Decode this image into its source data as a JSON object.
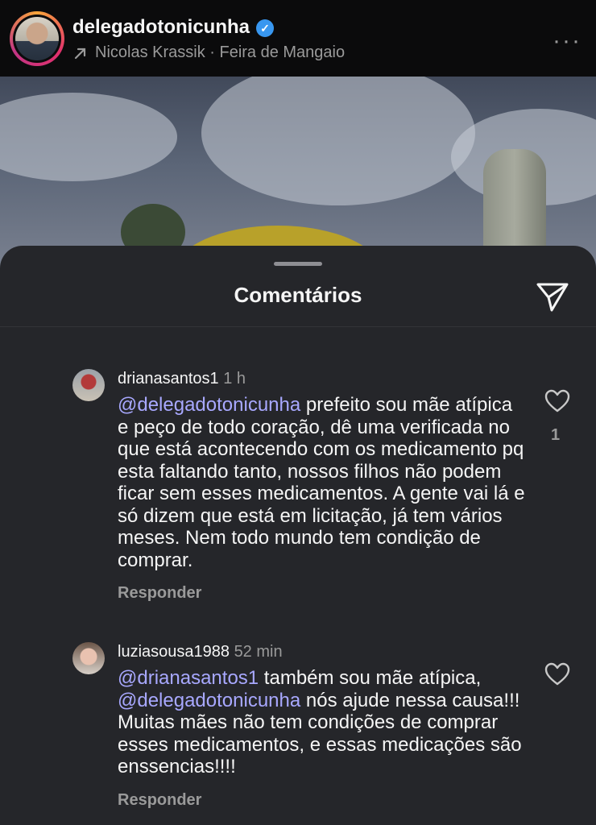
{
  "header": {
    "username": "delegadotonicunha",
    "verified_mark": "✓",
    "music_line": "Nicolas Krassik · Feira de Mangaio",
    "more": "···"
  },
  "sheet": {
    "title": "Comentários"
  },
  "comments": [
    {
      "username": "drianasantos1",
      "time": "1 h",
      "mention": "@delegadotonicunha",
      "text": " prefeito sou mãe atípica e peço de todo coração, dê uma verificada no que está acontecendo com os medicamento pq esta faltando tanto, nossos filhos não podem ficar sem esses medicamentos. A gente vai lá e só dizem que está em licitação, já tem vários meses. Nem todo mundo tem condição de comprar.",
      "likes": "1",
      "reply_label": "Responder"
    },
    {
      "username": "luziasousa1988",
      "time": "52 min",
      "mention": "@drianasantos1",
      "text_1": " também sou mãe atípica,",
      "mention_2": "@delegadotonicunha",
      "text_2": " nós ajude nessa causa!!! Muitas mães não tem condições de comprar esses medicamentos, e essas medicações são enssencias!!!!",
      "reply_label": "Responder"
    }
  ],
  "colors": {
    "mention": "#a8a8ff",
    "sheet_bg": "#25262a",
    "verified": "#3897f0"
  },
  "icons": [
    "arrow-up-right-icon",
    "more-icon",
    "send-icon",
    "heart-icon",
    "verified-icon"
  ]
}
